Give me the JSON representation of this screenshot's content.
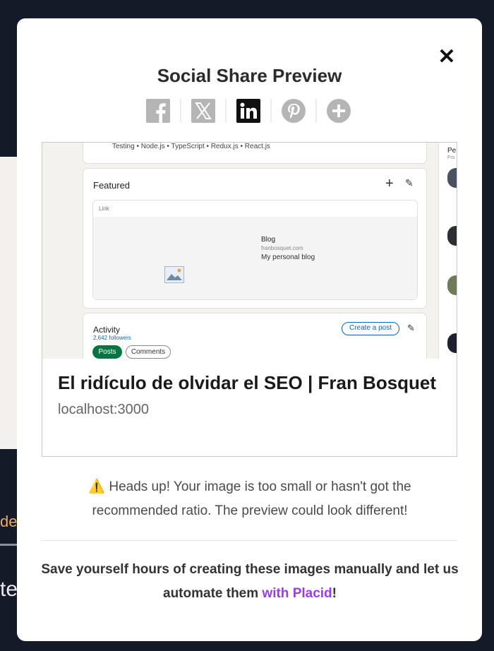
{
  "background": {
    "fragment_1": "de",
    "fragment_2": "te"
  },
  "modal": {
    "title": "Social Share Preview",
    "close_icon": "close-icon"
  },
  "share_icons": [
    {
      "name": "facebook-icon",
      "active": false
    },
    {
      "name": "x-twitter-icon",
      "active": false
    },
    {
      "name": "linkedin-icon",
      "active": true
    },
    {
      "name": "pinterest-icon",
      "active": false
    },
    {
      "name": "add-icon",
      "active": false
    }
  ],
  "preview": {
    "title": "El ridículo de olvidar el SEO | Fran Bosquet",
    "domain": "localhost:3000",
    "image": {
      "skills": "Testing • Node.js • TypeScript • Redux.js • React.js",
      "featured_title": "Featured",
      "link_label": "Link",
      "blog_title": "Blog",
      "blog_url": "franbosquet.com",
      "blog_desc": "My personal blog",
      "activity_title": "Activity",
      "followers": "2,642 followers",
      "create_post": "Create a post",
      "posts_tab": "Posts",
      "comments_tab": "Comments",
      "right_heading": "Pe",
      "right_sub": "Fro"
    }
  },
  "warning": {
    "emoji": "⚠️",
    "text": "Heads up! Your image is too small or hasn't got the recommended ratio. The preview could look different!"
  },
  "cta": {
    "text_before": "Save yourself hours of creating these images manually and let us automate them ",
    "link_text": "with Placid",
    "text_after": "!"
  },
  "colors": {
    "background": "#151a28",
    "accent_link": "#9b3ce4",
    "linkedin_active": "#111111",
    "icon_inactive": "#b5b5b5"
  }
}
